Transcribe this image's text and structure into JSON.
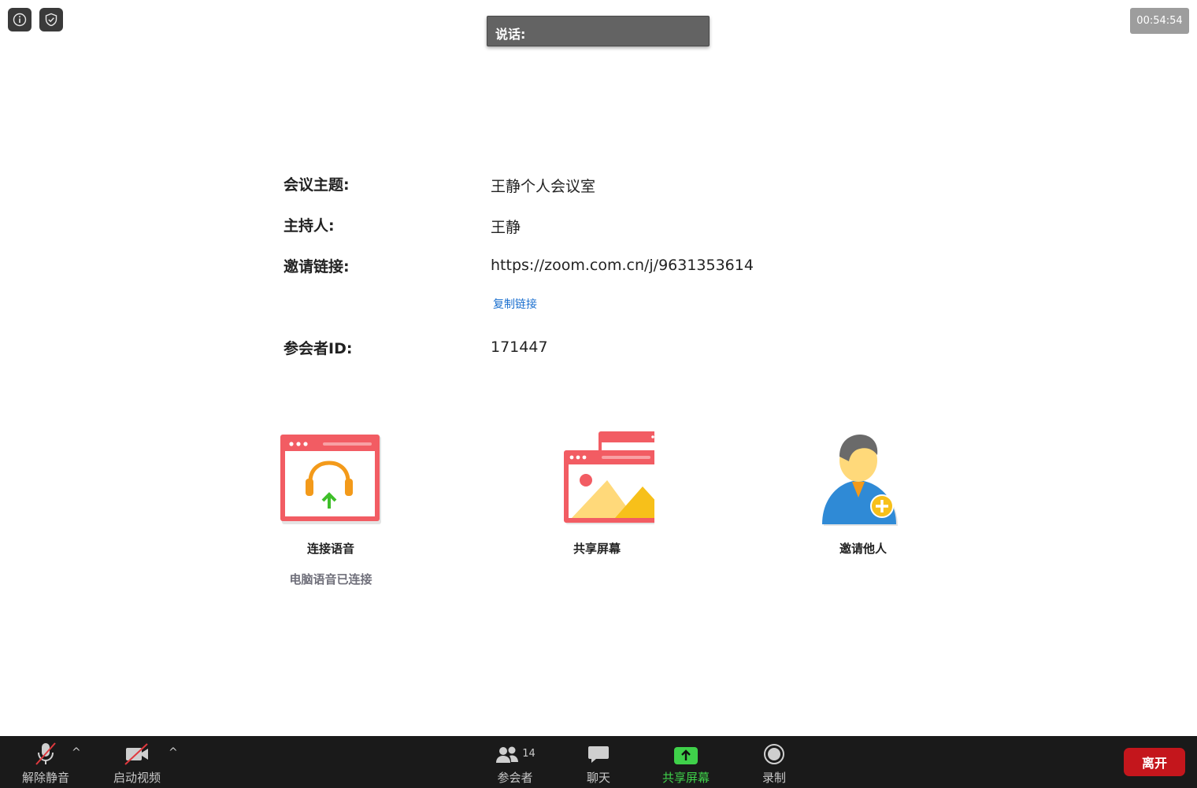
{
  "top": {
    "info_icon": "info-icon",
    "shield_icon": "shield-check-icon",
    "speaking_label": "说话:",
    "timer": "00:54:54"
  },
  "meeting": {
    "topic_label": "会议主题:",
    "topic_value": "王静个人会议室",
    "host_label": "主持人:",
    "host_value": "王静",
    "invite_label": "邀请链接:",
    "invite_value": "https://zoom.com.cn/j/9631353614",
    "copy_link": "复制链接",
    "participant_id_label": "参会者ID:",
    "participant_id_value": "171447"
  },
  "actions": {
    "audio_label": "连接语音",
    "audio_sub": "电脑语音已连接",
    "share_label": "共享屏幕",
    "invite_label": "邀请他人"
  },
  "toolbar": {
    "unmute": "解除静音",
    "start_video": "启动视频",
    "participants": "参会者",
    "participants_count": "14",
    "chat": "聊天",
    "share_screen": "共享屏幕",
    "record": "录制",
    "leave": "离开"
  },
  "colors": {
    "accent_red": "#f25c63",
    "share_green": "#3fd14a",
    "leave_red": "#c4161c",
    "link_blue": "#1a6fcf"
  }
}
